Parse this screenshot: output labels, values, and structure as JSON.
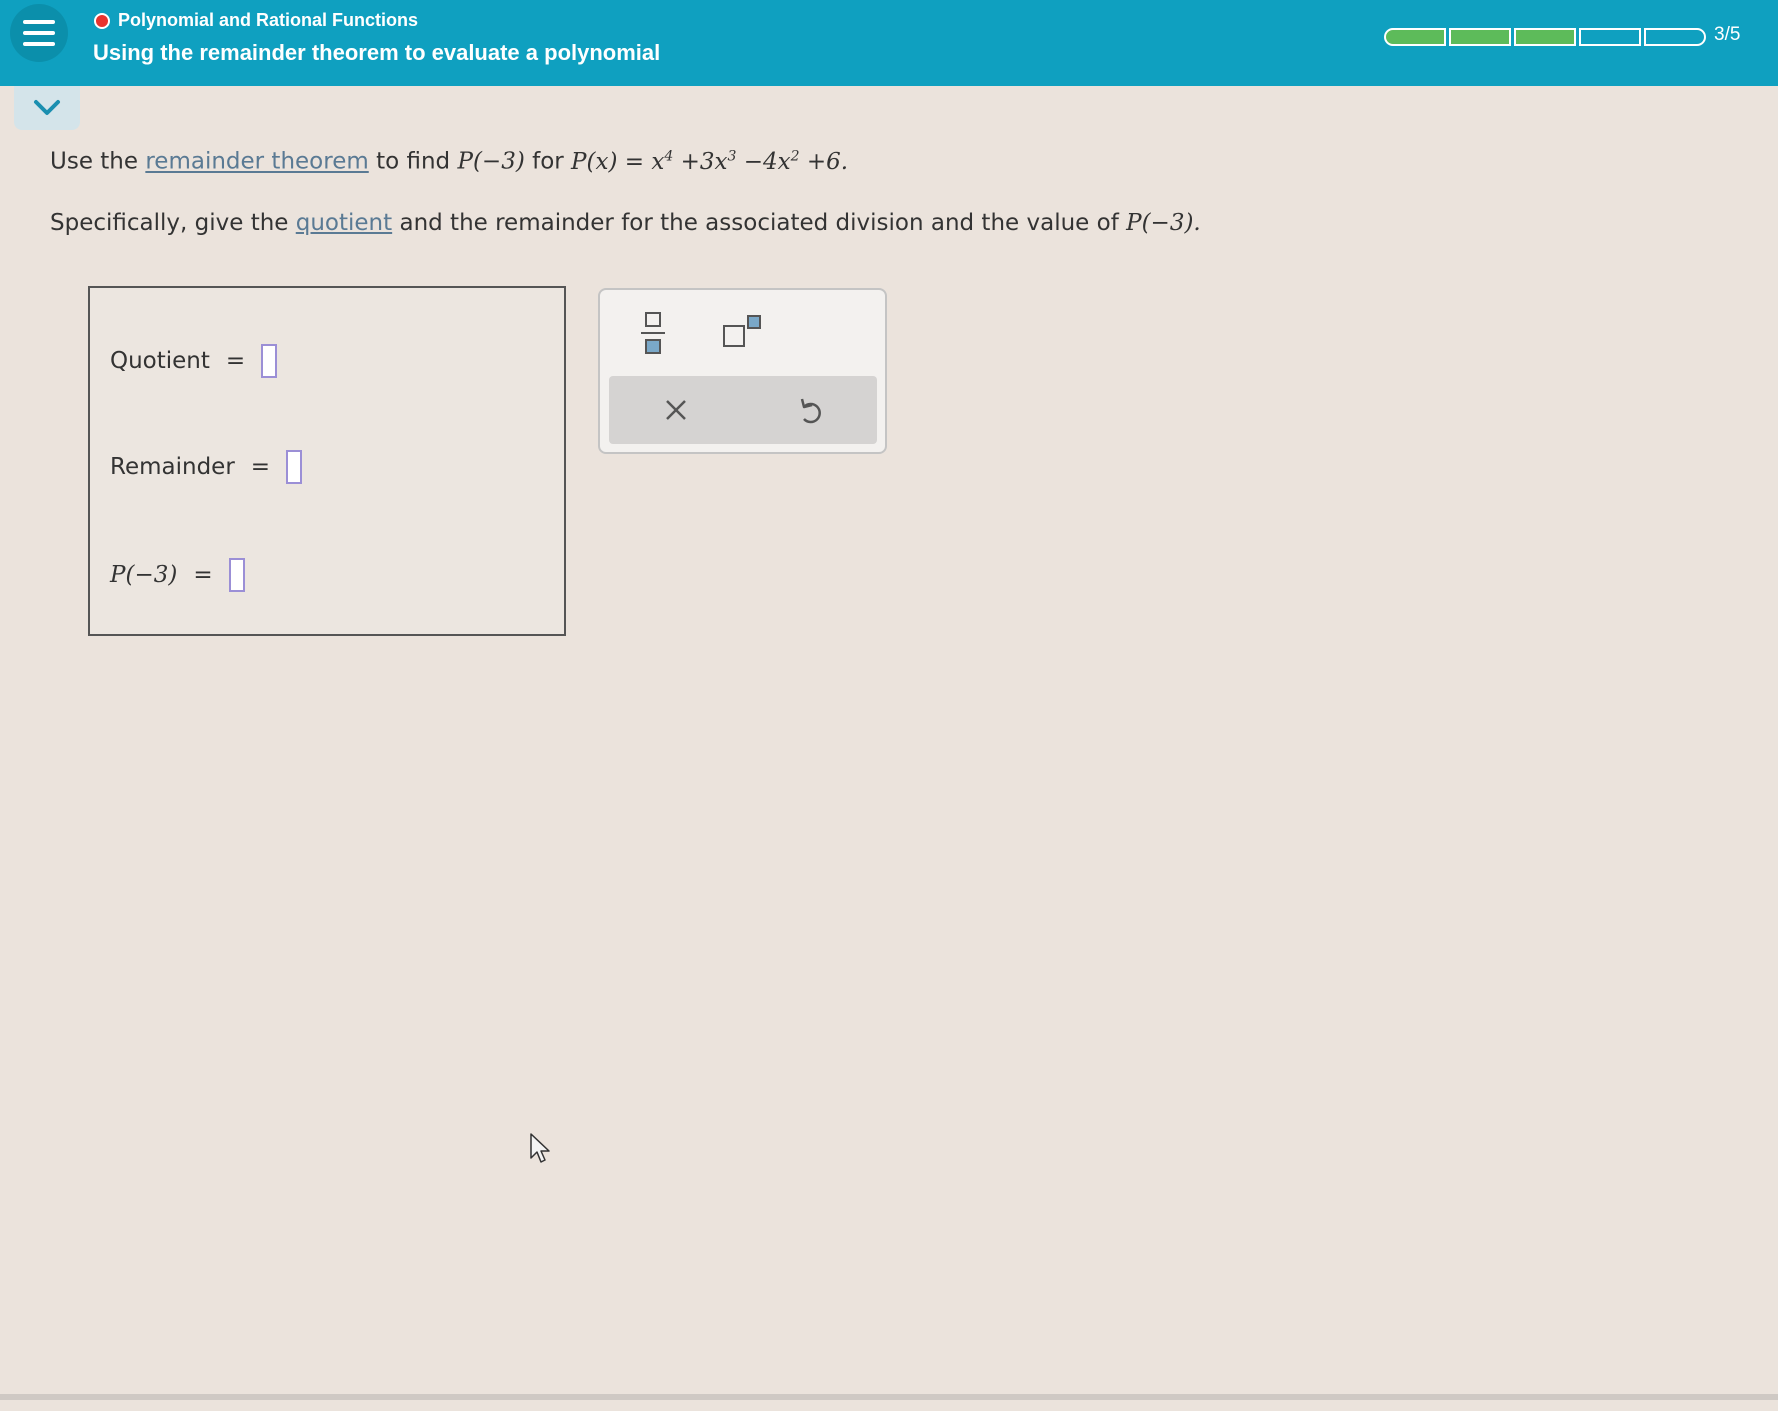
{
  "header": {
    "topic": "Polynomial and Rational Functions",
    "title": "Using the remainder theorem to evaluate a polynomial",
    "progress_text": "3/5",
    "progress_completed": 3,
    "progress_total": 5,
    "progress_color": "#5dbb5a",
    "bar_color": "#0fa0c0"
  },
  "question": {
    "line1_pre": "Use the",
    "line1_link": "remainder theorem",
    "line1_mid": "to find",
    "line1_target": "P(−3)",
    "line1_for": "for",
    "poly_lhs": "P(x)",
    "poly_eq": "=",
    "poly_t1": "x",
    "poly_e1": "4",
    "poly_t2": "+3x",
    "poly_e2": "3",
    "poly_t3": "−4x",
    "poly_e3": "2",
    "poly_t4": "+6.",
    "line2_pre": "Specifically, give the",
    "line2_link": "quotient",
    "line2_mid": "and the remainder for the associated division and the value of",
    "line2_target": "P(−3)."
  },
  "answers": {
    "quotient_label": "Quotient",
    "remainder_label": "Remainder",
    "p_label": "P(−3)",
    "equals": "="
  },
  "tools": {
    "fraction": "fraction-icon",
    "superscript": "superscript-icon",
    "clear": "close-icon",
    "undo": "undo-icon"
  }
}
